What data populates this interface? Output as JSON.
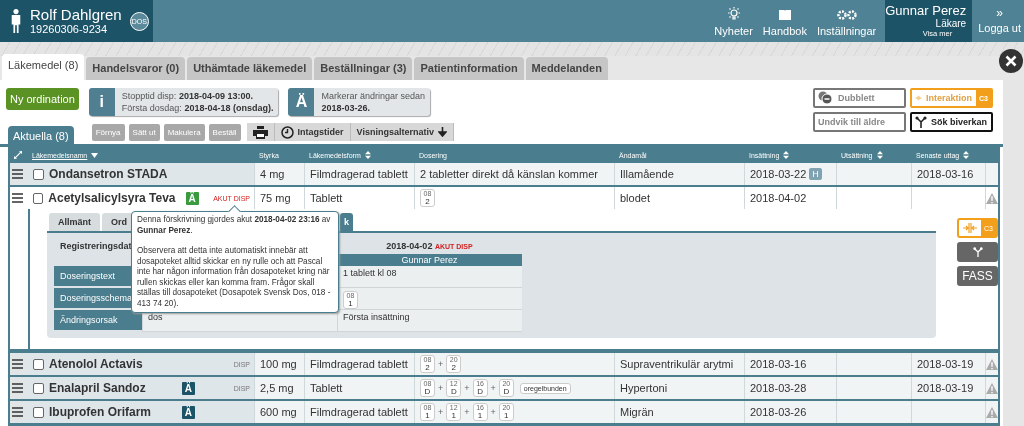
{
  "header": {
    "patient": {
      "name": "Rolf Dahlgren",
      "id": "19260306-9234",
      "badge": "DOS"
    },
    "nav": [
      {
        "label": "Nyheter"
      },
      {
        "label": "Handbok"
      },
      {
        "label": "Inställningar"
      }
    ],
    "user": {
      "name": "Gunnar Perez",
      "role": "Läkare",
      "link": "Visa mer"
    },
    "logout": {
      "icon": "»",
      "label": "Logga ut"
    }
  },
  "tabs": [
    {
      "label": "Läkemedel (8)",
      "selected": true
    },
    {
      "label": "Handelsvaror (0)",
      "selected": false
    },
    {
      "label": "Uthämtade läkemedel",
      "selected": false
    },
    {
      "label": "Beställningar (3)",
      "selected": false
    },
    {
      "label": "Patientinformation",
      "selected": false
    },
    {
      "label": "Meddelanden",
      "selected": false
    }
  ],
  "new_button": "Ny ordination",
  "notices": [
    {
      "icon": "i",
      "lines": [
        "Stopptid disp: **2018-04-09 13:00.**",
        "Första dosdag: **2018-04-18 (onsdag).**"
      ]
    },
    {
      "icon": "Ä",
      "lines": [
        "Markerar ändringar sedan",
        "**2018-03-26.**"
      ]
    }
  ],
  "checks": [
    {
      "label": "Dubblett",
      "kind": "dubblett"
    },
    {
      "label": "Interaktion",
      "kind": "interaktion",
      "badge": "C3"
    },
    {
      "label": "Undvik till äldre",
      "kind": "plain"
    },
    {
      "label": "Sök biverkan",
      "kind": "biverkan"
    }
  ],
  "list_tabs": [
    {
      "label": "Aktuella (8)",
      "selected": true
    }
  ],
  "actions": [
    {
      "label": "Förnya",
      "disabled": true
    },
    {
      "label": "Sätt ut",
      "disabled": true
    },
    {
      "label": "Makulera",
      "disabled": true
    },
    {
      "label": "Beställ",
      "disabled": true
    }
  ],
  "tools": [
    {
      "kind": "print"
    },
    {
      "kind": "clock",
      "label": "Intagstider"
    },
    {
      "kind": "dropdown",
      "label": "Visningsalternativ"
    }
  ],
  "table": {
    "columns": [
      {
        "label": "Läkemedelsnamn",
        "kind": "sorted"
      },
      {
        "label": "Styrka",
        "kind": "plain"
      },
      {
        "label": "Läkemedelsform",
        "kind": "sortable"
      },
      {
        "label": "Dosering",
        "kind": "plain"
      },
      {
        "label": "Ändamål",
        "kind": "plain"
      },
      {
        "label": "Insättning",
        "kind": "sortable"
      },
      {
        "label": "Utsättning",
        "kind": "sortable"
      },
      {
        "label": "Senaste uttag",
        "kind": "sortable"
      }
    ],
    "rows": [
      {
        "name": "Ondansetron STADA",
        "checked": false,
        "expanded": false,
        "strength": "4 mg",
        "form": "Filmdragerad tablett",
        "dosing": {
          "kind": "text",
          "text": "2 tabletter direkt då känslan kommer"
        },
        "purpose": "Illamående",
        "start": "2018-03-22",
        "start_badge": "H",
        "last": "2018-03-16",
        "warning": false
      },
      {
        "name": "Acetylsalicylsyra Teva",
        "checked": false,
        "expanded": true,
        "change_mark": {
          "text": "Ä",
          "color": "#3a9a3e"
        },
        "disp": {
          "text": "AKUT DISP",
          "kind": "akut"
        },
        "strength": "75 mg",
        "form": "Tablett",
        "dosing": {
          "kind": "schema",
          "doses": [
            {
              "time": "08",
              "amount": "2"
            }
          ]
        },
        "purpose": "blodet",
        "start": "2018-04-02",
        "warning": true
      },
      {
        "name": "Atenolol Actavis",
        "checked": false,
        "expanded": false,
        "disp": {
          "text": "DISP",
          "kind": "normal"
        },
        "strength": "100 mg",
        "form": "Filmdragerad tablett",
        "dosing": {
          "kind": "schema",
          "joiner": "+",
          "doses": [
            {
              "time": "08",
              "amount": "2"
            },
            {
              "time": "20",
              "amount": "2"
            }
          ]
        },
        "purpose": "Supraventrikulär arytmi",
        "start": "2018-03-16",
        "last": "2018-03-19",
        "warning": true
      },
      {
        "name": "Enalapril Sandoz",
        "checked": false,
        "expanded": false,
        "change_mark": {
          "text": "Ä",
          "color": "#1d5366"
        },
        "disp": {
          "text": "DISP",
          "kind": "normal"
        },
        "strength": "2,5 mg",
        "form": "Tablett",
        "dosing": {
          "kind": "schema",
          "joiner": "+",
          "doses": [
            {
              "time": "08",
              "amount": "D"
            },
            {
              "time": "12",
              "amount": "D"
            },
            {
              "time": "16",
              "amount": "D"
            },
            {
              "time": "20",
              "amount": "D"
            }
          ],
          "tag": "oregelbunden"
        },
        "purpose": "Hypertoni",
        "start": "2018-03-28",
        "last": "2018-03-19",
        "warning": true
      },
      {
        "name": "Ibuprofen Orifarm",
        "checked": false,
        "expanded": false,
        "change_mark": {
          "text": "Ä",
          "color": "#1d5366"
        },
        "strength": "600 mg",
        "form": "Filmdragerad tablett",
        "dosing": {
          "kind": "schema",
          "joiner": "+",
          "doses": [
            {
              "time": "08",
              "amount": "1"
            },
            {
              "time": "12",
              "amount": "1"
            },
            {
              "time": "16",
              "amount": "1"
            },
            {
              "time": "20",
              "amount": "1"
            }
          ]
        },
        "purpose": "Migrän",
        "start": "2018-03-26",
        "warning": true
      }
    ]
  },
  "detail": {
    "tabs": [
      {
        "label": "Allmänt",
        "selected": false
      },
      {
        "label": "Ord",
        "selected": false
      },
      {
        "label": "k",
        "selected": true
      }
    ],
    "reg_label": "Registreringsdat",
    "date": "2018-04-02",
    "date_tag": "AKUT DISP",
    "by": "Gunnar Perez",
    "rows": [
      {
        "label": "Doseringstext",
        "value": "1 tablett kl 08"
      },
      {
        "label": "Doseringsschema",
        "doses": [
          {
            "time": "08",
            "amount": "1"
          }
        ]
      },
      {
        "label": "Ändringsorsak",
        "old": "dos",
        "value": "Första insättning"
      }
    ],
    "side": [
      {
        "kind": "interaktion",
        "badge": "C3"
      },
      {
        "kind": "biverkan"
      },
      {
        "kind": "fass",
        "label": "FASS"
      }
    ],
    "tooltip": [
      "Denna förskrivning gjordes akut **2018-04-02 23:16** av **Gunnar Perez**.",
      "Observera att detta inte automatiskt innebär att dosapoteket alltid skickar en ny rulle och att Pascal inte har någon information från dosapoteket kring när rullen skickas eller kan komma fram. Frågor skall ställas till dosapoteket (Dosapotek Svensk Dos, 018 - 413 74 20)."
    ]
  }
}
